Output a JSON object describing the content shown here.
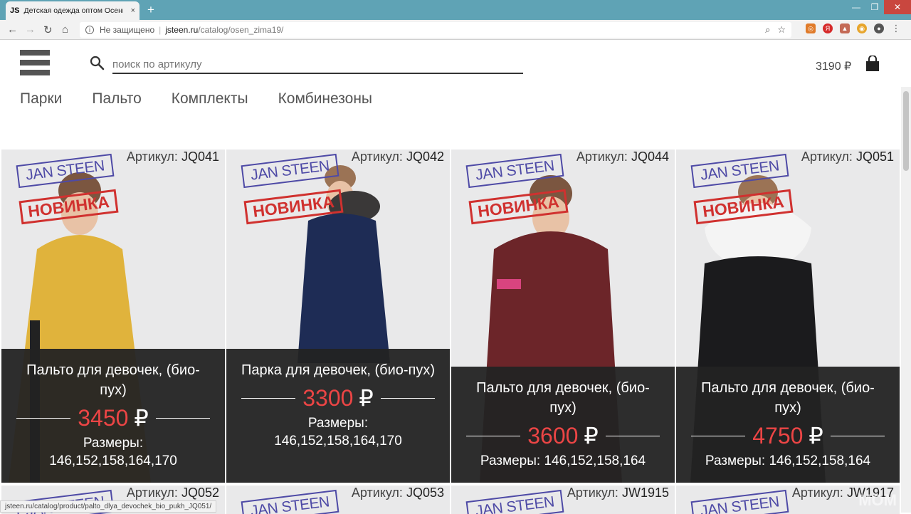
{
  "browser": {
    "tab_favicon": "JS",
    "tab_title": "Детская одежда оптом Осень-З",
    "tab_close": "×",
    "new_tab": "+",
    "not_secure": "Не защищено",
    "url_host": "jsteen.ru",
    "url_path": "/catalog/osen_zima19/",
    "status_url": "jsteen.ru/catalog/product/palto_dlya_devochek_bio_pukh_JQ051/"
  },
  "header": {
    "search_placeholder": "поиск по артикулу",
    "cart_total": "3190 ₽"
  },
  "nav": [
    "Парки",
    "Пальто",
    "Комплекты",
    "Комбинезоны"
  ],
  "stamp": {
    "brand": "JAN STEEN",
    "new": "НОВИНКА"
  },
  "article_label": "Артикул:",
  "currency": "₽",
  "products": [
    {
      "article": "JQ041",
      "name": "Пальто для девочек, (био-пух)",
      "price": "3450",
      "sizes_label": "Размеры:",
      "sizes": "146,152,158,164,170",
      "color": "#e0b33c"
    },
    {
      "article": "JQ042",
      "name": "Парка для девочек, (био-пух)",
      "price": "3300",
      "sizes_label": "Размеры:",
      "sizes": "146,152,158,164,170",
      "color": "#1e2c55"
    },
    {
      "article": "JQ044",
      "name": "Пальто для девочек, (био-пух)",
      "price": "3600",
      "sizes_label": "Размеры:",
      "sizes": "146,152,158,164",
      "color": "#6c2529"
    },
    {
      "article": "JQ051",
      "name": "Пальто для девочек, (био-пух)",
      "price": "4750",
      "sizes_label": "Размеры:",
      "sizes": "146,152,158,164",
      "color": "#1b1b1d"
    }
  ],
  "products_row2": [
    {
      "article": "JQ052"
    },
    {
      "article": "JQ053"
    },
    {
      "article": "JW1915"
    },
    {
      "article": "JW1917"
    }
  ],
  "watermark": "MOM"
}
